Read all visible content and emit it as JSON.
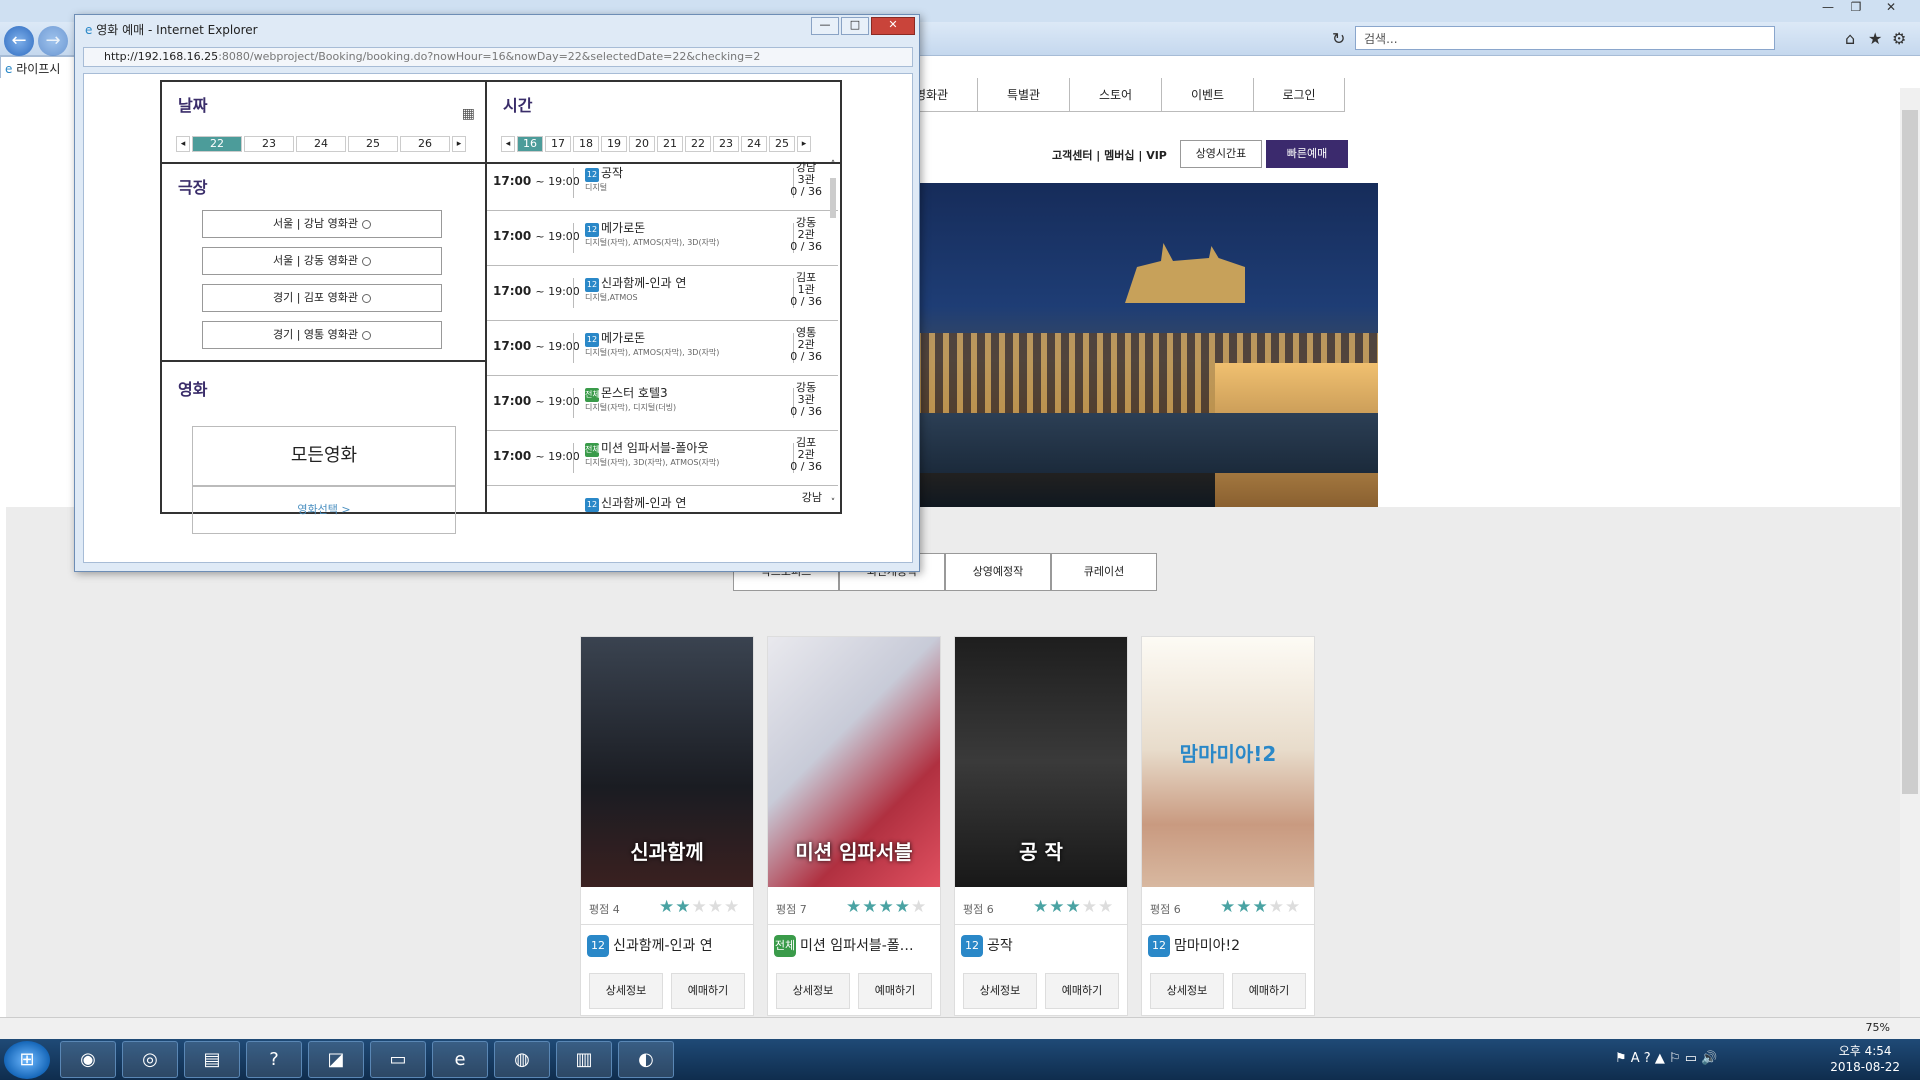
{
  "browser": {
    "search_placeholder": "검색...",
    "tab_label": "라이프시",
    "zoom": "75%"
  },
  "site": {
    "nav": [
      "영화관",
      "특별관",
      "스토어",
      "이벤트",
      "로그인"
    ],
    "util_links": "고객센터 | 멤버십 | VIP",
    "showtime_button": "상영시간표",
    "quick_button": "빠른예매"
  },
  "movie_tabs": [
    "박스오피스",
    "최신개봉작",
    "상영예정작",
    "큐레이션"
  ],
  "movies": [
    {
      "poster_title": "신과함께",
      "rating_label": "평점 4",
      "stars": 2,
      "age": "12",
      "title": "신과함께-인과 연",
      "detail": "상세정보",
      "book": "예매하기"
    },
    {
      "poster_title": "미션 임파서블",
      "rating_label": "평점 7",
      "stars": 4,
      "age": "전체",
      "title": "미션 임파서블-폴…",
      "detail": "상세정보",
      "book": "예매하기"
    },
    {
      "poster_title": "공 작",
      "rating_label": "평점 6",
      "stars": 3,
      "age": "12",
      "title": "공작",
      "detail": "상세정보",
      "book": "예매하기"
    },
    {
      "poster_title": "맘마미아!2",
      "rating_label": "평점 6",
      "stars": 3,
      "age": "12",
      "title": "맘마미아!2",
      "detail": "상세정보",
      "book": "예매하기"
    }
  ],
  "popup": {
    "title": "영화 예매 - Internet Explorer",
    "url_host": "http://192.168.16.25",
    "url_path": ":8080/webproject/Booking/booking.do?nowHour=16&nowDay=22&selectedDate=22&checking=2",
    "date_heading": "날짜",
    "dates": [
      "22",
      "23",
      "24",
      "25",
      "26"
    ],
    "selected_date": "22",
    "theater_heading": "극장",
    "theaters": [
      "서울 | 강남 영화관",
      "서울 | 강동 영화관",
      "경기 | 김포 영화관",
      "경기 | 영통 영화관"
    ],
    "movie_heading": "영화",
    "all_movies": "모든영화",
    "movie_select": "영화선택 >",
    "time_heading": "시간",
    "hours": [
      "16",
      "17",
      "18",
      "19",
      "20",
      "21",
      "22",
      "23",
      "24",
      "25"
    ],
    "selected_hour": "16",
    "sessions": [
      {
        "start": "17:00",
        "end": "~ 19:00",
        "age": "12",
        "movie": "공작",
        "format": "디지털",
        "room1": "강남",
        "room2": "3관",
        "seats": "0 / 36"
      },
      {
        "start": "17:00",
        "end": "~ 19:00",
        "age": "12",
        "movie": "메가로돈",
        "format": "디지털(자막), ATMOS(자막), 3D(자막)",
        "room1": "강동",
        "room2": "2관",
        "seats": "0 / 36"
      },
      {
        "start": "17:00",
        "end": "~ 19:00",
        "age": "12",
        "movie": "신과함께-인과 연",
        "format": "디지털,ATMOS",
        "room1": "김포",
        "room2": "1관",
        "seats": "0 / 36"
      },
      {
        "start": "17:00",
        "end": "~ 19:00",
        "age": "12",
        "movie": "메가로돈",
        "format": "디지털(자막), ATMOS(자막), 3D(자막)",
        "room1": "영통",
        "room2": "2관",
        "seats": "0 / 36"
      },
      {
        "start": "17:00",
        "end": "~ 19:00",
        "age": "전체",
        "movie": "몬스터 호텔3",
        "format": "디지털(자막), 디지털(더빙)",
        "room1": "강동",
        "room2": "3관",
        "seats": "0 / 36"
      },
      {
        "start": "17:00",
        "end": "~ 19:00",
        "age": "전체",
        "movie": "미션 임파서블-폴아웃",
        "format": "디지털(자막), 3D(자막), ATMOS(자막)",
        "room1": "김포",
        "room2": "2관",
        "seats": "0 / 36"
      },
      {
        "start": "",
        "end": "",
        "age": "12",
        "movie": "신과함께-인과 연",
        "format": "",
        "room1": "강남",
        "room2": "",
        "seats": ""
      }
    ]
  },
  "taskbar": {
    "clock_time": "오후 4:54",
    "clock_date": "2018-08-22"
  },
  "colors": {
    "accent_teal": "#4c9c9a",
    "brand_purple": "#3b2a6d",
    "age12": "#2a88c8",
    "age_all": "#3a9b4a"
  }
}
